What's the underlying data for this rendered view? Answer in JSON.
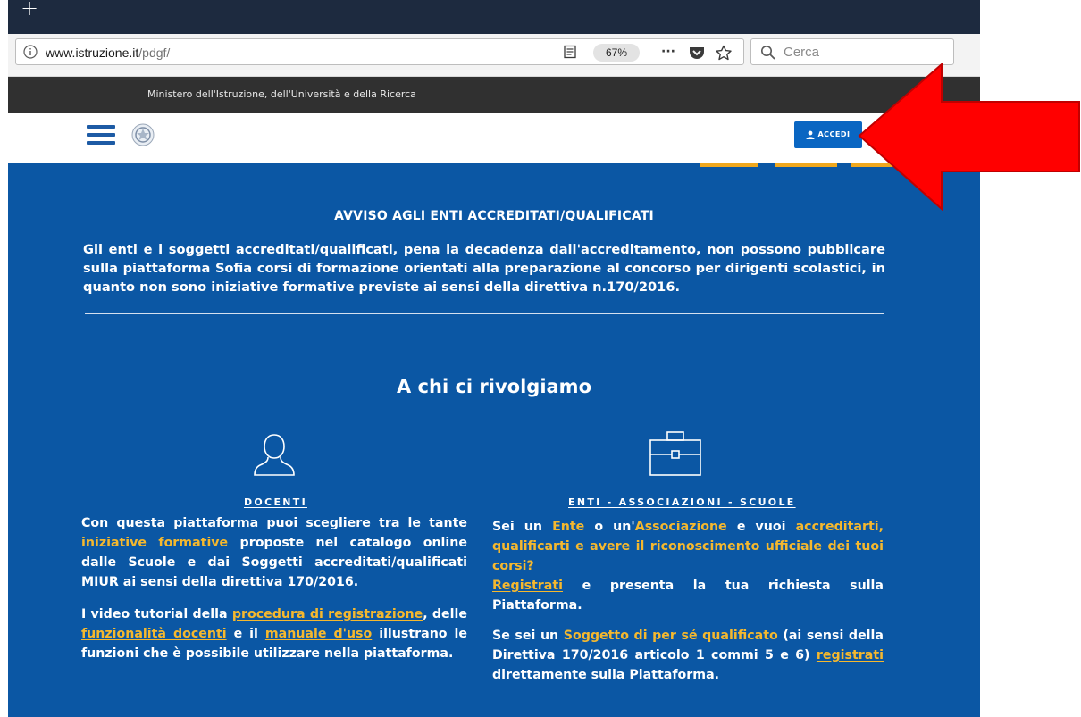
{
  "browser": {
    "new_tab_symbol": "+",
    "url_host": "www.istruzione.it",
    "url_path": "/pdgf/",
    "zoom": "67%",
    "more_symbol": "···",
    "search_placeholder": "Cerca"
  },
  "ministry": {
    "text": "Ministero dell'Istruzione, dell'Università e della Ricerca"
  },
  "header": {
    "login_label": "ACCEDI"
  },
  "notice": {
    "title": "AVVISO AGLI ENTI ACCREDITATI/QUALIFICATI",
    "body": "Gli enti e i soggetti accreditati/qualificati, pena la decadenza dall'accreditamento, non possono pubblicare sulla piattaforma Sofia corsi di formazione orientati alla preparazione al concorso per dirigenti scolastici, in quanto non sono iniziative formative previste ai sensi della direttiva n.170/2016."
  },
  "section": {
    "title": "A chi ci rivolgiamo"
  },
  "docenti": {
    "heading": "DOCENTI",
    "p1_a": "Con questa piattaforma puoi scegliere tra le tante ",
    "p1_link": "iniziative formative",
    "p1_b": " proposte nel catalogo online dalle Scuole e dai Soggetti accreditati/qualificati MIUR ai sensi della direttiva 170/2016.",
    "p2_a": "I video tutorial della ",
    "p2_link1": "procedura di registrazione",
    "p2_b": ", delle ",
    "p2_link2": "funzionalità docenti",
    "p2_c": " e il ",
    "p2_link3": "manuale d'uso",
    "p2_d": " illustrano le funzioni che è possibile utilizzare nella piattaforma."
  },
  "enti": {
    "heading": "ENTI - ASSOCIAZIONI - SCUOLE",
    "p1_a": "Sei un ",
    "p1_h1": "Ente",
    "p1_b": " o un'",
    "p1_h2": "Associazione",
    "p1_c": " e vuoi ",
    "p1_h3": "accreditarti, qualificarti e avere il riconoscimento ufficiale dei tuoi corsi?",
    "p1_link": "Registrati",
    "p1_d": " e presenta la tua richiesta sulla Piattaforma.",
    "p2_a": "Se sei un ",
    "p2_h": "Soggetto di per sé qualificato",
    "p2_b": " (ai sensi della Direttiva 170/2016 articolo 1 commi 5 e 6) ",
    "p2_link": "registrati",
    "p2_c": " direttamente sulla Piattaforma."
  },
  "colors": {
    "main_blue": "#0b57a4",
    "highlight": "#f5b82e",
    "arrow": "#ff0000",
    "button_blue": "#0a66c2"
  }
}
